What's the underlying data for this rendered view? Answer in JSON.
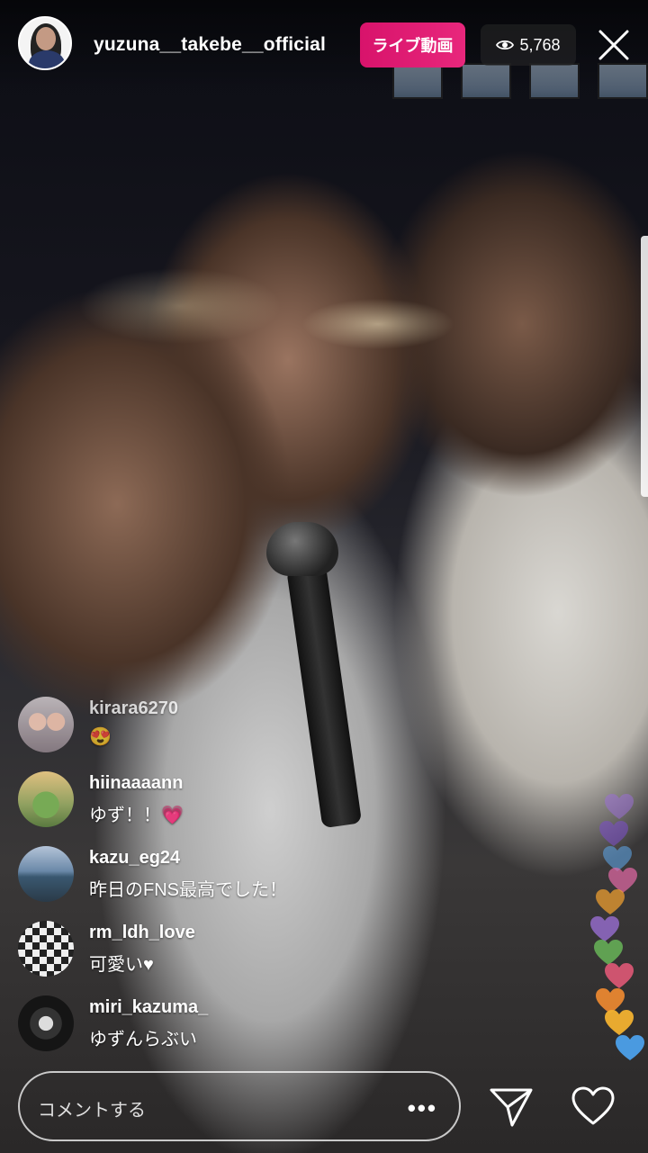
{
  "header": {
    "username": "yuzuna__takebe__official",
    "live_label": "ライブ動画",
    "viewer_count": "5,768",
    "icons": {
      "viewers": "eye-icon",
      "close": "close-icon"
    }
  },
  "comments": [
    {
      "username": "kirara6270",
      "text": "😍"
    },
    {
      "username": "hiinaaaann",
      "text": "ゆず！！💗"
    },
    {
      "username": "kazu_eg24",
      "text": "昨日のFNS最高でした！"
    },
    {
      "username": "rm_ldh_love",
      "text": "可愛い♥"
    },
    {
      "username": "miri_kazuma_",
      "text": "ゆずんらぶい"
    }
  ],
  "composer": {
    "placeholder": "コメントする",
    "more": "•••",
    "icons": {
      "send": "send-icon",
      "like": "heart-icon"
    }
  },
  "colors": {
    "live_badge": "#dd1a72",
    "hearts": [
      "#9b6fd6",
      "#7a4fc4",
      "#5b9bd6",
      "#e86aa8",
      "#f0a030",
      "#9b6fd6",
      "#6aba5a",
      "#e85a7a",
      "#f08a30",
      "#f0b030",
      "#4a9ae0"
    ]
  }
}
